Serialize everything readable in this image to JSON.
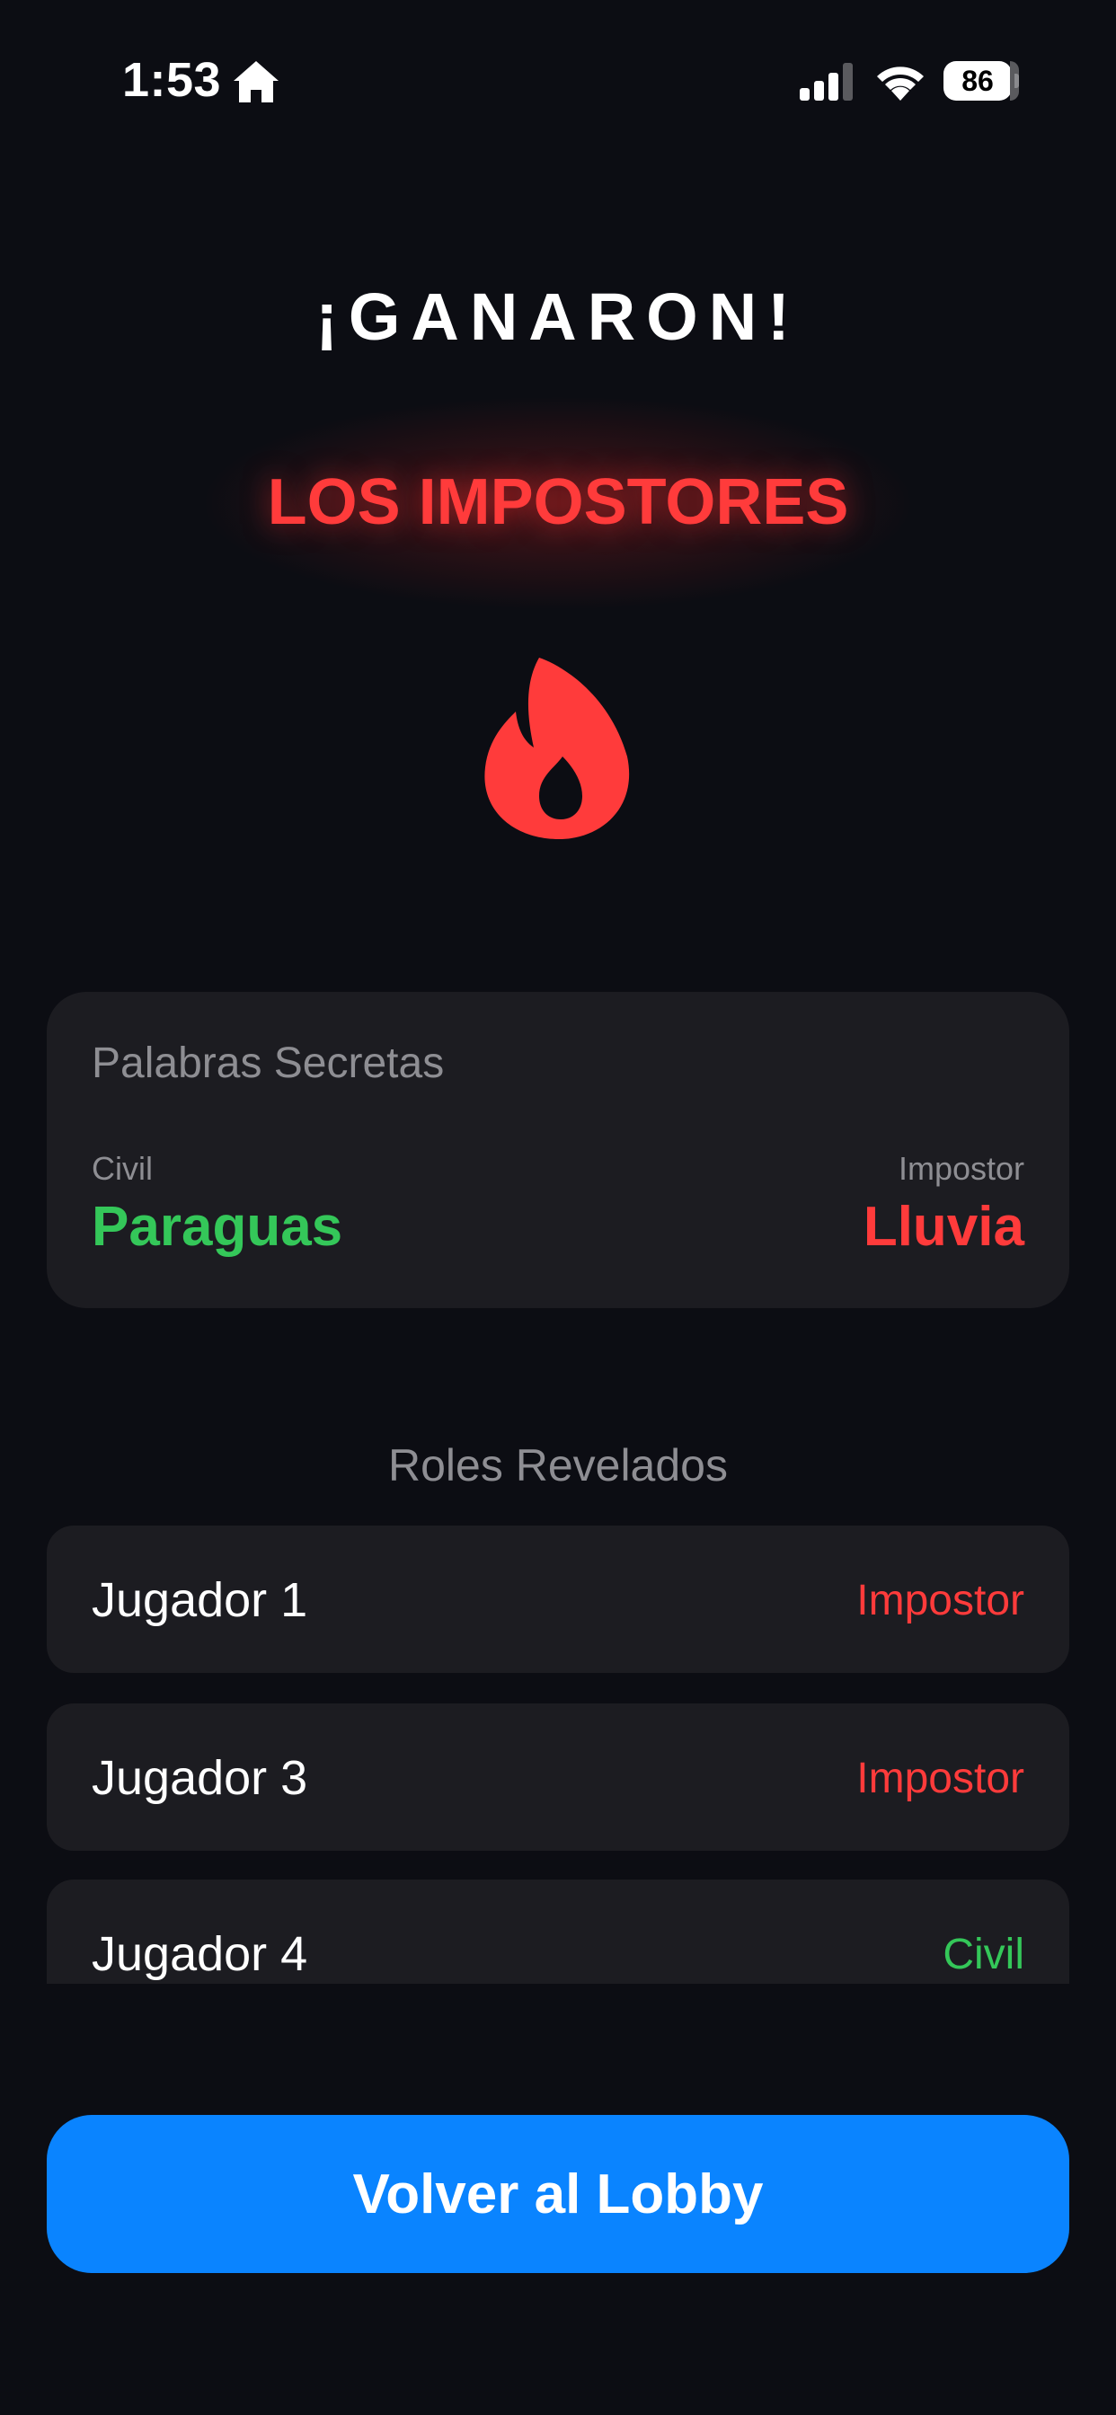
{
  "status_bar": {
    "time": "1:53",
    "battery": "86",
    "icons": [
      "home-icon",
      "signal-icon",
      "wifi-icon",
      "battery-icon"
    ]
  },
  "result": {
    "title": "¡GANARON!",
    "team": "LOS IMPOSTORES",
    "icon": "flame-icon",
    "accent_color": "#ff3b3b"
  },
  "secret_words": {
    "title": "Palabras Secretas",
    "civil_label": "Civil",
    "civil_word": "Paraguas",
    "impostor_label": "Impostor",
    "impostor_word": "Lluvia",
    "civil_color": "#34c759",
    "impostor_color": "#ff3b3b"
  },
  "roles": {
    "title": "Roles Revelados",
    "players": [
      {
        "name": "Jugador 1",
        "role": "Impostor"
      },
      {
        "name": "Jugador 3",
        "role": "Impostor"
      },
      {
        "name": "Jugador 4",
        "role": "Civil"
      }
    ]
  },
  "actions": {
    "back_to_lobby": "Volver al Lobby",
    "button_color": "#0a84ff"
  }
}
